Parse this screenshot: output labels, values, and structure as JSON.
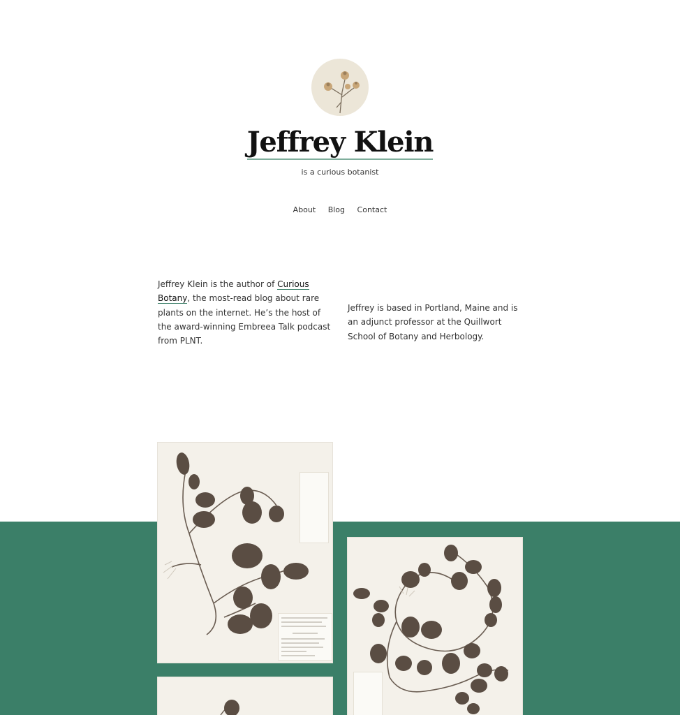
{
  "site": {
    "title": "Jeffrey Klein",
    "tagline": "is a curious botanist"
  },
  "nav": {
    "items": [
      {
        "label": "About"
      },
      {
        "label": "Blog"
      },
      {
        "label": "Contact"
      }
    ]
  },
  "intro": {
    "left_before": "Jeffrey Klein is the author of ",
    "left_link": "Curious Botany",
    "left_after": ", the most-read blog about rare plants on the internet. He’s the host of the award-winning Embreea Talk podcast from PLNT.",
    "right": "Jeffrey is based in Portland, Maine and is an adjunct professor at the Quillwort School of Botany and Herbology."
  },
  "gallery": {
    "images": [
      {
        "icon": "pressed-vine-specimen"
      },
      {
        "icon": "pressed-vine-specimen"
      },
      {
        "icon": "pressed-vine-specimen"
      }
    ]
  },
  "colors": {
    "accent": "#3b7f68",
    "underline": "#7fae9c",
    "paper": "#f4f1ea",
    "leaf": "#5a4d43"
  }
}
